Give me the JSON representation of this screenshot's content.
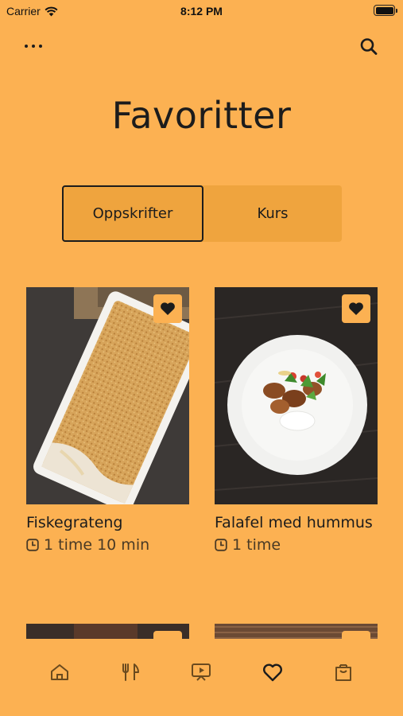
{
  "status_bar": {
    "carrier": "Carrier",
    "time": "8:12 PM"
  },
  "header": {
    "title": "Favoritter"
  },
  "segments": {
    "recipes_label": "Oppskrifter",
    "courses_label": "Kurs",
    "selected": "Oppskrifter"
  },
  "cards": [
    {
      "title": "Fiskegrateng",
      "time": "1 time 10 min",
      "favorited": true
    },
    {
      "title": "Falafel med hummus",
      "time": "1 time",
      "favorited": true
    }
  ],
  "tab_bar": {
    "items": [
      "home-icon",
      "cutlery-icon",
      "video-icon",
      "heart-icon",
      "bag-icon"
    ],
    "selected": "heart-icon"
  },
  "colors": {
    "background": "#FCB152",
    "segment_bg": "#EFA43E",
    "text": "#1c1c1c"
  }
}
